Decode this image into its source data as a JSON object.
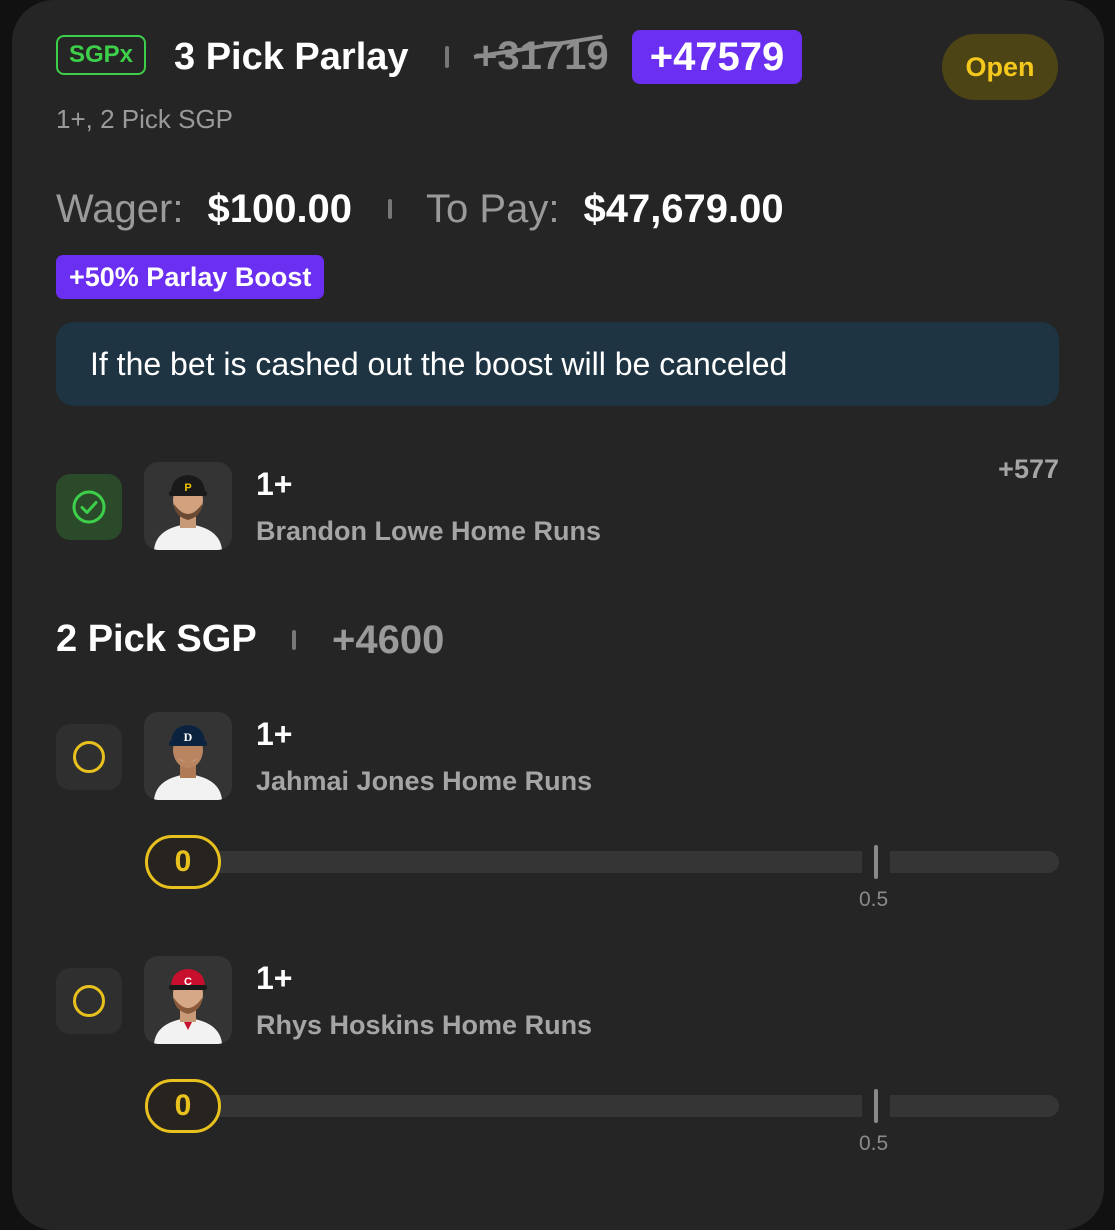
{
  "header": {
    "badge": "SGPx",
    "title": "3 Pick Parlay",
    "original_odds": "+31719",
    "boosted_odds": "+47579",
    "status": "Open",
    "subtitle": "1+, 2 Pick SGP"
  },
  "wager": {
    "wager_label": "Wager:",
    "wager_value": "$100.00",
    "payout_label": "To Pay:",
    "payout_value": "$47,679.00"
  },
  "boost_tag": "+50% Parlay Boost",
  "notice": "If the bet is cashed out the boost will be canceled",
  "legs": [
    {
      "line": "1+",
      "description": "Brandon Lowe Home Runs",
      "odds": "+577",
      "status": "won",
      "cap_color": "#1a1a1a",
      "cap_logo": "P",
      "cap_logo_color": "#f2c300",
      "jersey_color": "#f2f2f2"
    }
  ],
  "group": {
    "title": "2 Pick SGP",
    "odds": "+4600",
    "legs": [
      {
        "line": "1+",
        "description": "Jahmai Jones Home Runs",
        "status": "open",
        "progress_value": "0",
        "target_label": "0.5",
        "cap_color": "#0c2340",
        "cap_logo": "D",
        "cap_logo_color": "#ffffff",
        "jersey_color": "#f2f2f2"
      },
      {
        "line": "1+",
        "description": "Rhys Hoskins Home Runs",
        "status": "open",
        "progress_value": "0",
        "target_label": "0.5",
        "cap_color": "#c8102e",
        "cap_logo": "C",
        "cap_logo_color": "#ffffff",
        "jersey_color": "#f2f2f2"
      }
    ]
  },
  "colors": {
    "background": "#252525",
    "accent_purple": "#6b2ff2",
    "sgpx_green": "#3ecf4a",
    "open_yellow": "#f4c81c",
    "notice_bg": "#1e3442"
  }
}
